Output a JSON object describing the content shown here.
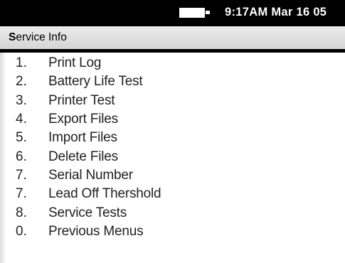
{
  "status_bar": {
    "time_date": "9:17AM Mar 16 05",
    "battery_icon": "battery-icon"
  },
  "title_bar": {
    "title_first_letter": "S",
    "title_rest": "ervice Info"
  },
  "menu": {
    "items": [
      {
        "number": "1.",
        "label": "Print Log"
      },
      {
        "number": "2.",
        "label": "Battery Life Test"
      },
      {
        "number": "3.",
        "label": "Printer Test"
      },
      {
        "number": "4.",
        "label": "Export Files"
      },
      {
        "number": "5.",
        "label": "Import Files"
      },
      {
        "number": "6.",
        "label": "Delete Files"
      },
      {
        "number": "7.",
        "label": "Serial Number"
      },
      {
        "number": "7.",
        "label": "Lead Off Thershold"
      },
      {
        "number": "8.",
        "label": "Service Tests"
      },
      {
        "number": "0.",
        "label": "Previous Menus"
      }
    ]
  }
}
